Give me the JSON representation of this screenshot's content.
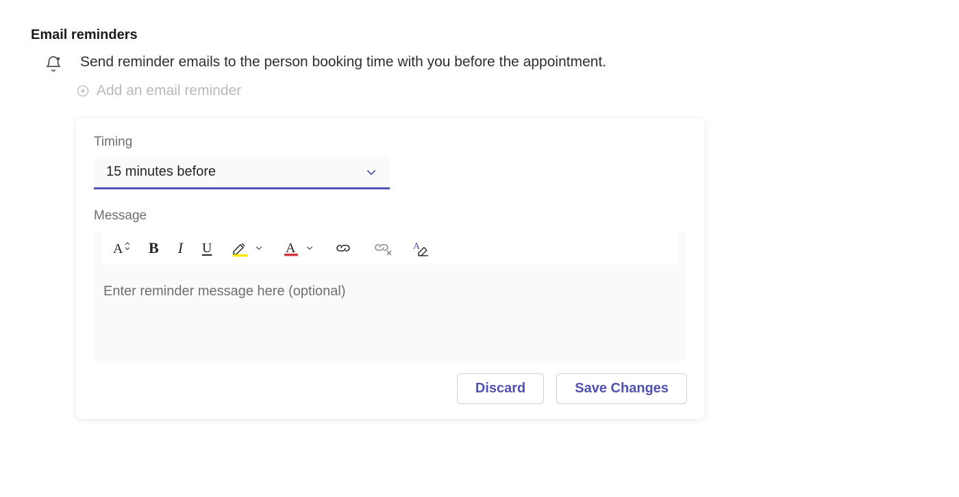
{
  "section": {
    "title": "Email reminders",
    "description": "Send reminder emails to the person booking time with you before the appointment.",
    "add_label": "Add an email reminder"
  },
  "form": {
    "timing_label": "Timing",
    "timing_value": "15 minutes before",
    "message_label": "Message",
    "message_placeholder": "Enter reminder message here (optional)"
  },
  "toolbar": {
    "font_size": "font-size",
    "bold": "B",
    "italic": "I",
    "underline": "U",
    "highlight": "highlight",
    "font_color": "font-color",
    "insert_link": "insert-link",
    "remove_link": "remove-link",
    "clear_format": "clear-formatting"
  },
  "buttons": {
    "discard": "Discard",
    "save": "Save Changes"
  },
  "colors": {
    "accent": "#4f52b2",
    "highlight_swatch": "#ffe600",
    "fontcolor_swatch": "#d13438"
  }
}
